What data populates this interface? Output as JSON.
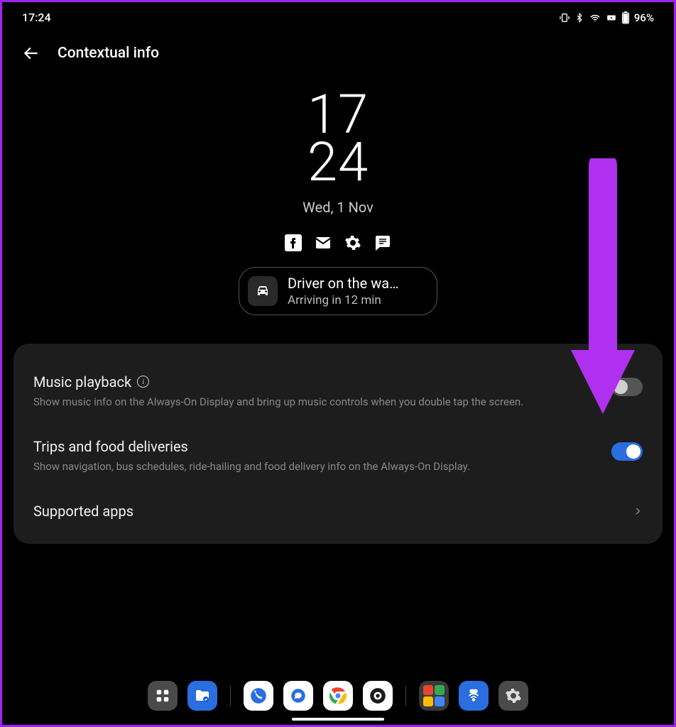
{
  "status": {
    "time": "17:24",
    "battery_pct": "96%"
  },
  "header": {
    "title": "Contextual info"
  },
  "preview": {
    "hour": "17",
    "minute": "24",
    "date": "Wed, 1 Nov",
    "card_title": "Driver on the wa…",
    "card_subtitle": "Arriving in 12 min"
  },
  "settings": {
    "music": {
      "title": "Music playback",
      "desc": "Show music info on the Always-On Display and bring up music controls when you double tap the screen.",
      "enabled": false
    },
    "trips": {
      "title": "Trips and food deliveries",
      "desc": "Show navigation, bus schedules, ride-hailing and food delivery info on the Always-On Display.",
      "enabled": true
    },
    "supported": {
      "title": "Supported apps"
    }
  }
}
